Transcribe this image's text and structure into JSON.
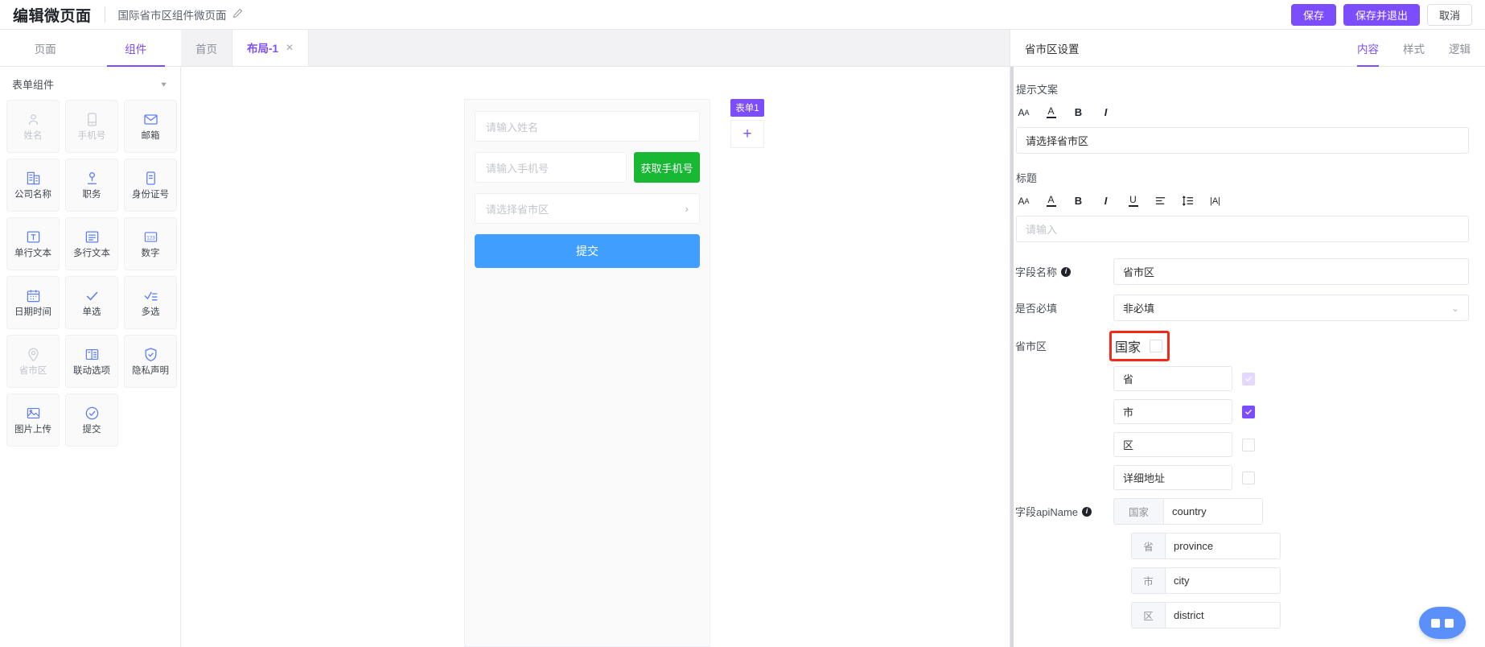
{
  "topbar": {
    "app_title": "编辑微页面",
    "page_name": "国际省市区组件微页面",
    "edit_icon": "pencil-icon",
    "save_label": "保存",
    "save_exit_label": "保存并退出",
    "cancel_label": "取消"
  },
  "left_tabs": [
    {
      "label": "页面",
      "active": false
    },
    {
      "label": "组件",
      "active": true
    }
  ],
  "canvas_tabs": [
    {
      "label": "首页",
      "active": false,
      "closable": false
    },
    {
      "label": "布局-1",
      "active": true,
      "closable": true,
      "close_icon": "close-icon"
    }
  ],
  "palette": {
    "group_title": "表单组件",
    "collapse_icon": "chevron-down-icon",
    "tiles": [
      {
        "label": "姓名",
        "icon": "user-icon",
        "disabled": true
      },
      {
        "label": "手机号",
        "icon": "mobile-icon",
        "disabled": true
      },
      {
        "label": "邮箱",
        "icon": "mail-icon",
        "disabled": false
      },
      {
        "label": "公司名称",
        "icon": "building-icon",
        "disabled": false
      },
      {
        "label": "职务",
        "icon": "badge-icon",
        "disabled": false
      },
      {
        "label": "身份证号",
        "icon": "idcard-icon",
        "disabled": false
      },
      {
        "label": "单行文本",
        "icon": "text-single-icon",
        "disabled": false
      },
      {
        "label": "多行文本",
        "icon": "text-multi-icon",
        "disabled": false
      },
      {
        "label": "数字",
        "icon": "number-icon",
        "disabled": false
      },
      {
        "label": "日期时间",
        "icon": "calendar-icon",
        "disabled": false
      },
      {
        "label": "单选",
        "icon": "check-icon",
        "disabled": false
      },
      {
        "label": "多选",
        "icon": "checklist-icon",
        "disabled": false
      },
      {
        "label": "省市区",
        "icon": "location-pin-icon",
        "disabled": true
      },
      {
        "label": "联动选项",
        "icon": "cascader-icon",
        "disabled": false
      },
      {
        "label": "隐私声明",
        "icon": "shield-icon",
        "disabled": false
      },
      {
        "label": "图片上传",
        "icon": "image-upload-icon",
        "disabled": false
      },
      {
        "label": "提交",
        "icon": "submit-icon",
        "disabled": false
      }
    ]
  },
  "canvas": {
    "form_badge": "表单1",
    "add_icon": "plus-icon",
    "preview": {
      "name_placeholder": "请输入姓名",
      "phone_placeholder": "请输入手机号",
      "get_code_label": "获取手机号",
      "region_placeholder": "请选择省市区",
      "region_arrow_icon": "chevron-right-icon",
      "submit_label": "提交"
    }
  },
  "panel": {
    "title": "省市区设置",
    "tabs": [
      {
        "label": "内容",
        "active": true
      },
      {
        "label": "样式",
        "active": false
      },
      {
        "label": "逻辑",
        "active": false
      }
    ],
    "hint_section": {
      "label": "提示文案",
      "toolbar": [
        {
          "name": "font-size-icon",
          "glyph": "Aa"
        },
        {
          "name": "font-color-icon",
          "glyph": "A"
        },
        {
          "name": "bold-icon",
          "glyph": "B"
        },
        {
          "name": "italic-icon",
          "glyph": "I"
        }
      ],
      "value": "请选择省市区"
    },
    "title_section": {
      "label": "标题",
      "toolbar": [
        {
          "name": "font-size-icon",
          "glyph": "Aa"
        },
        {
          "name": "font-color-icon",
          "glyph": "A"
        },
        {
          "name": "bold-icon",
          "glyph": "B"
        },
        {
          "name": "italic-icon",
          "glyph": "I"
        },
        {
          "name": "underline-icon",
          "glyph": "U"
        },
        {
          "name": "align-left-icon",
          "glyph": "align"
        },
        {
          "name": "line-height-icon",
          "glyph": "lineheight"
        },
        {
          "name": "letter-spacing-icon",
          "glyph": "|A|"
        }
      ],
      "placeholder": "请输入",
      "value": ""
    },
    "field_name": {
      "label": "字段名称",
      "info_icon": "info-icon",
      "value": "省市区"
    },
    "required": {
      "label": "是否必填",
      "value": "非必填",
      "chevron_icon": "chevron-down-icon"
    },
    "region": {
      "label": "省市区",
      "rows": [
        {
          "value": "国家",
          "checked": "none",
          "highlighted": true
        },
        {
          "value": "省",
          "checked": "light",
          "highlighted": false
        },
        {
          "value": "市",
          "checked": "full",
          "highlighted": false
        },
        {
          "value": "区",
          "checked": "none",
          "highlighted": false
        },
        {
          "value": "详细地址",
          "checked": "none",
          "highlighted": false
        }
      ]
    },
    "api_name": {
      "label": "字段apiName",
      "info_icon": "info-icon",
      "rows": [
        {
          "prefix": "国家",
          "value": "country"
        },
        {
          "prefix": "省",
          "value": "province"
        },
        {
          "prefix": "市",
          "value": "city"
        },
        {
          "prefix": "区",
          "value": "district"
        }
      ]
    }
  },
  "assistant": {
    "name": "robot-assistant-button"
  },
  "colors": {
    "brand_purple": "#7c4dff",
    "accent_blue": "#409EFF",
    "green": "#18b835",
    "highlight_red": "#f42a17"
  }
}
